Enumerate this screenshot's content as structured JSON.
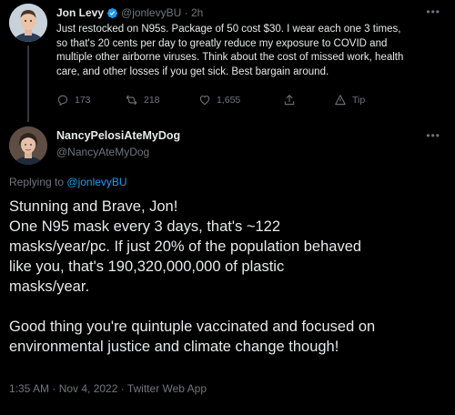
{
  "parent_tweet": {
    "author_name": "Jon Levy",
    "author_handle": "@jonlevyBU",
    "time_sep": "·",
    "time": "2h",
    "more_icon": "more-horizontal-icon",
    "body_lines": [
      "Just restocked on N95s. Package of 50 cost $30. I wear each one 3 times,",
      "so that's 20 cents per day to greatly reduce my exposure to COVID and",
      "multiple other airborne viruses. Think about the cost of missed work, health",
      "care, and other losses if you get sick. Best bargain around."
    ],
    "actions": {
      "replies": "173",
      "retweets": "218",
      "likes": "1,655",
      "tip": "Tip"
    }
  },
  "reply_tweet": {
    "author_name": "NancyPelosiAteMyDog",
    "author_handle": "@NancyAteMyDog",
    "replying_prefix": "Replying to",
    "replying_handle": "@jonlevyBU",
    "body_lines": [
      "Stunning and Brave, Jon!",
      "One N95 mask every 3 days, that's ~122",
      "masks/year/pc. If just 20% of the population behaved",
      "like you, that's 190,320,000,000 of plastic",
      "masks/year.",
      "",
      "Good thing you're quintuple vaccinated and focused on",
      "environmental justice and climate change though!"
    ],
    "timestamp": "1:35 AM · Nov 4, 2022 · Twitter Web App"
  },
  "colors": {
    "background": "#000000",
    "text": "#e7e9ea",
    "muted": "#71767b",
    "link": "#1d9bf0",
    "verified": "#1d9bf0"
  }
}
